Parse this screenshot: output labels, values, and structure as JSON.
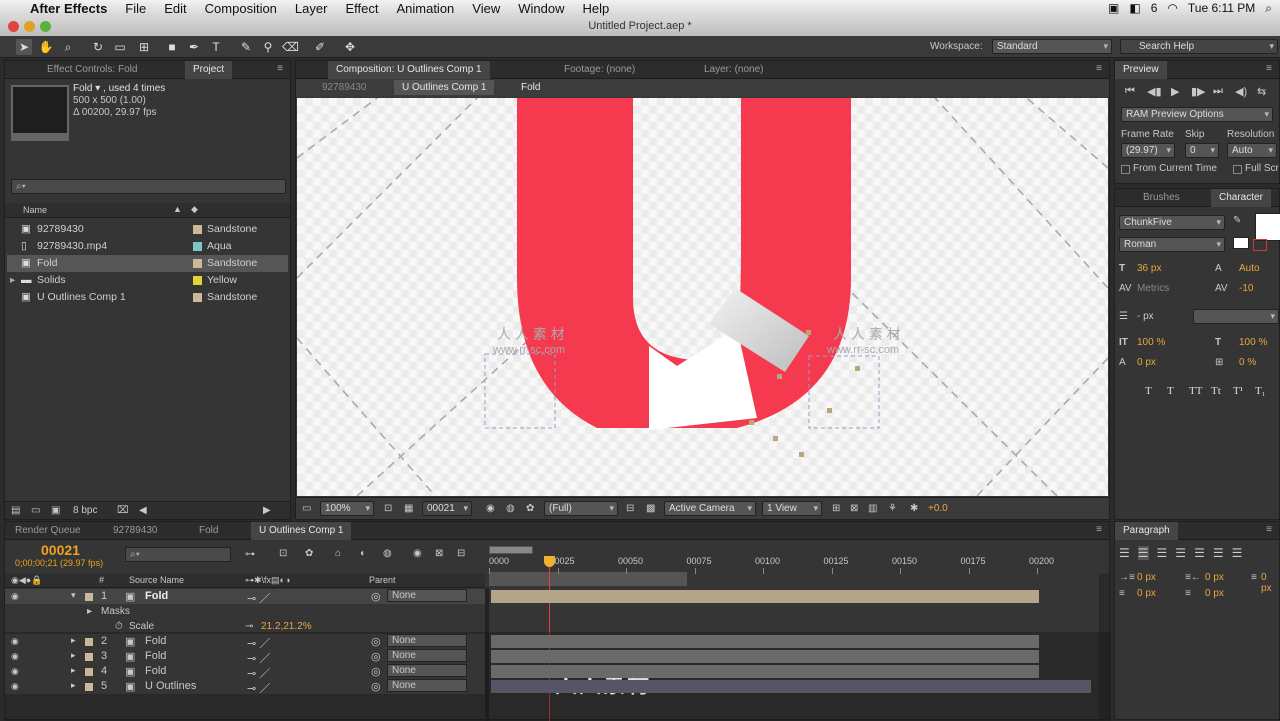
{
  "menubar": {
    "app_name": "After Effects",
    "items": [
      "File",
      "Edit",
      "Composition",
      "Layer",
      "Effect",
      "Animation",
      "View",
      "Window",
      "Help"
    ],
    "clock": "Tue 6:11 PM",
    "status_num": "6"
  },
  "window_title": "Untitled Project.aep *",
  "toolbar": {
    "workspace_label": "Workspace:",
    "workspace_value": "Standard",
    "search_placeholder": "Search Help"
  },
  "project_panel": {
    "tabs": [
      "Effect Controls: Fold",
      "Project"
    ],
    "info": {
      "name": "Fold ▾ , used 4 times",
      "dims": "500 x 500 (1.00)",
      "duration": "Δ 00200, 29.97 fps"
    },
    "search_placeholder": "⌕▾",
    "col_name": "Name",
    "items": [
      {
        "name": "92789430",
        "label": "Sandstone",
        "color": "#c9b89a",
        "icon": "comp-icon"
      },
      {
        "name": "92789430.mp4",
        "label": "Aqua",
        "color": "#7ec6c1",
        "icon": "file-icon"
      },
      {
        "name": "Fold",
        "label": "Sandstone",
        "color": "#c9b89a",
        "icon": "comp-icon"
      },
      {
        "name": "Solids",
        "label": "Yellow",
        "color": "#e3d23a",
        "icon": "folder-icon"
      },
      {
        "name": "U Outlines Comp 1",
        "label": "Sandstone",
        "color": "#c9b89a",
        "icon": "comp-icon"
      }
    ],
    "bpc": "8 bpc"
  },
  "comp_panel": {
    "tabs": [
      "Composition: U Outlines Comp 1",
      "Footage: (none)",
      "Layer: (none)"
    ],
    "breadcrumbs": [
      "92789430",
      "U Outlines Comp 1",
      "Fold"
    ],
    "zoom": "100%",
    "timecode": "00021",
    "resolution": "(Full)",
    "camera": "Active Camera",
    "view": "1 View",
    "exposure": "+0.0",
    "watermark_cn": "人 人 素 材",
    "watermark_url": "www.rr-sc.com"
  },
  "preview_panel": {
    "tab": "Preview",
    "ram_options": "RAM Preview Options",
    "frame_rate_label": "Frame Rate",
    "skip_label": "Skip",
    "resolution_label": "Resolution",
    "frame_rate_value": "(29.97)",
    "skip_value": "0",
    "resolution_value": "Auto",
    "from_current": "From Current Time",
    "full_screen": "Full Scr"
  },
  "character_panel": {
    "tabs": [
      "Brushes",
      "Character"
    ],
    "font": "ChunkFive",
    "style": "Roman",
    "size": "36 px",
    "leading": "Auto",
    "kerning": "Metrics",
    "tracking": "-10",
    "stroke": "- px",
    "vscale": "100 %",
    "hscale": "100 %",
    "baseline": "0 px",
    "tsume": "0 %",
    "styles": [
      "T",
      "T",
      "TT",
      "Tt",
      "T¹",
      "T₁"
    ]
  },
  "paragraph_panel": {
    "tab": "Paragraph",
    "values": [
      "0 px",
      "0 px",
      "0 px",
      "0 px",
      "0 px"
    ]
  },
  "timeline": {
    "tabs": [
      "Render Queue",
      "92789430",
      "Fold",
      "U Outlines Comp 1"
    ],
    "timecode": "00021",
    "timecode_sub": "0;00;00;21 (29.97 fps)",
    "col_source": "Source Name",
    "col_parent": "Parent",
    "ruler": [
      "0000",
      "00025",
      "00050",
      "00075",
      "00100",
      "00125",
      "00150",
      "00175",
      "00200"
    ],
    "layers": [
      {
        "num": "1",
        "name": "Fold",
        "parent": "None"
      },
      {
        "num": "2",
        "name": "Fold",
        "parent": "None"
      },
      {
        "num": "3",
        "name": "Fold",
        "parent": "None"
      },
      {
        "num": "4",
        "name": "Fold",
        "parent": "None"
      },
      {
        "num": "5",
        "name": "U Outlines",
        "parent": "None"
      }
    ],
    "masks_label": "Masks",
    "scale_label": "Scale",
    "scale_value": "21.2,21.2%",
    "overlay_text": "人人素材"
  },
  "colors": {
    "accent_orange": "#f0a020",
    "red_shape": "#f53a4f",
    "layer_bar": "#b4a488"
  }
}
